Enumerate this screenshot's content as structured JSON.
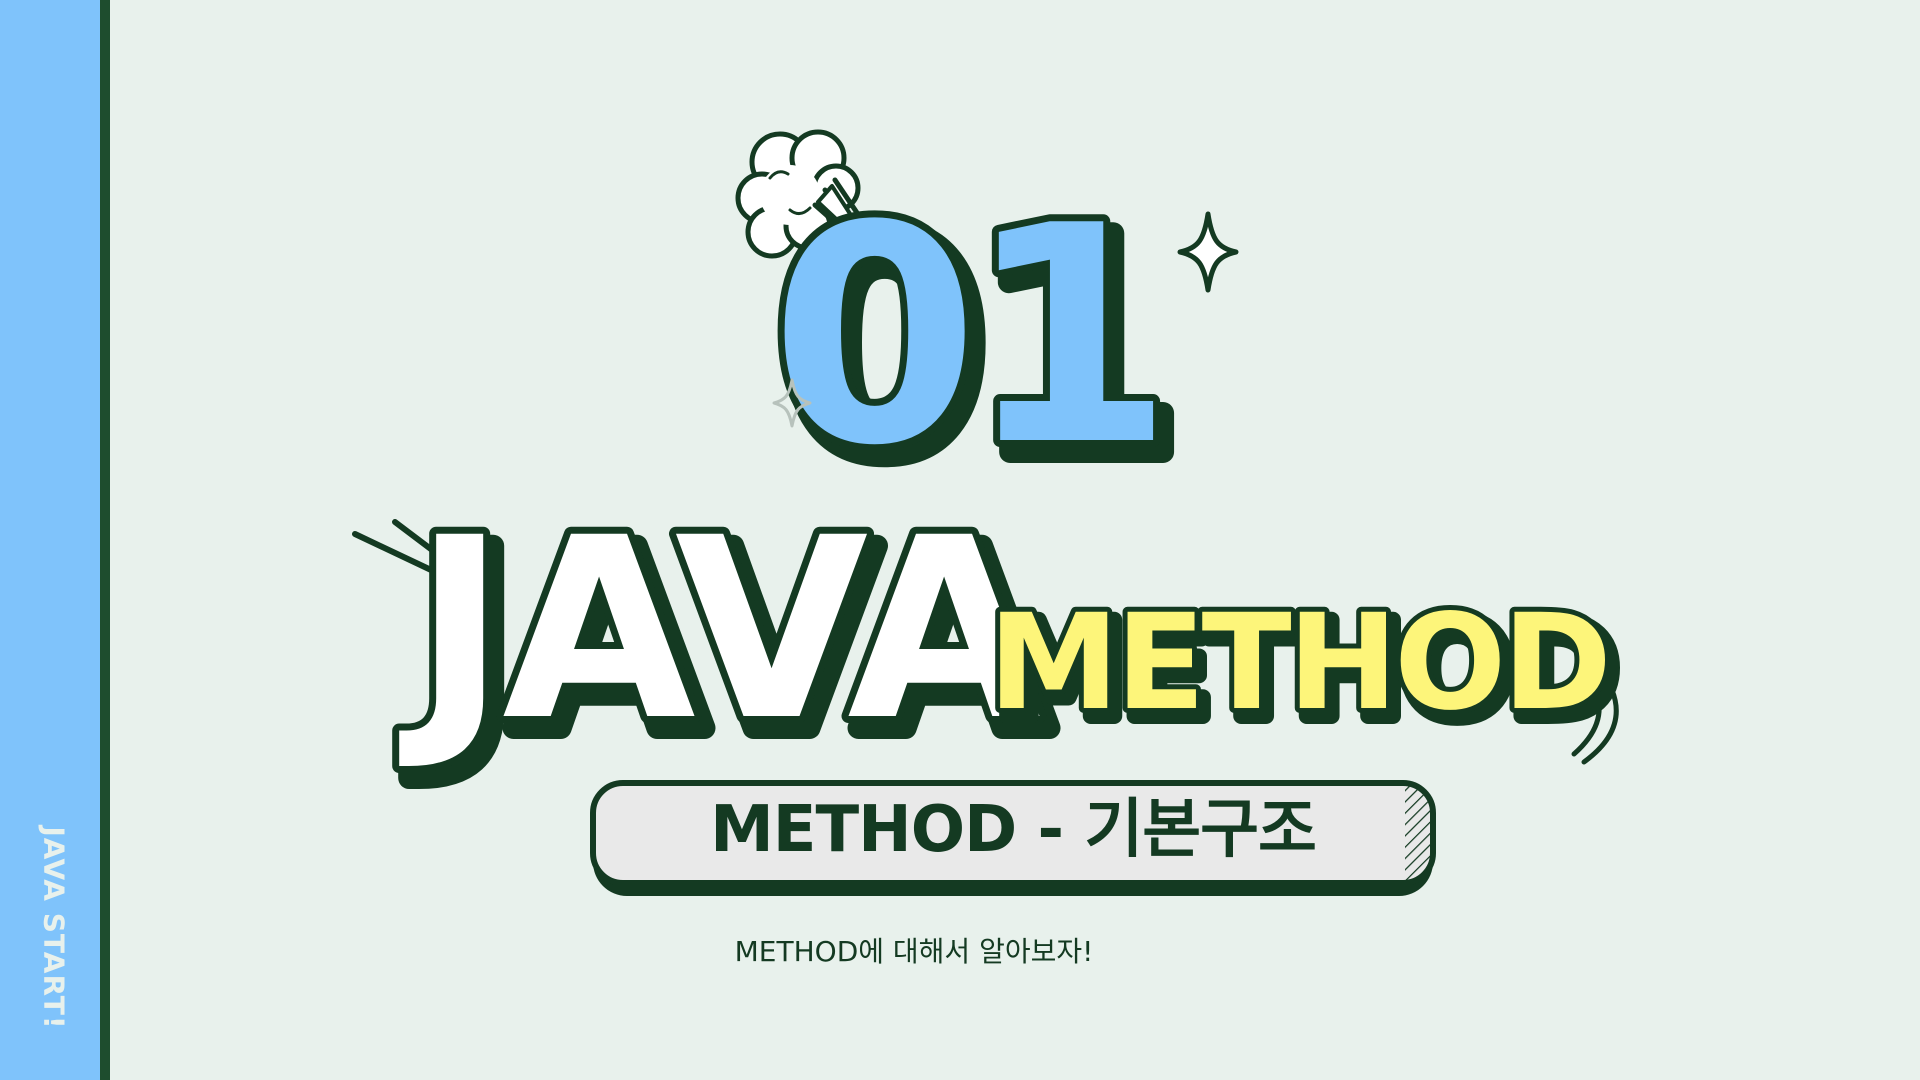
{
  "side_label": "JAVA START!",
  "number": "01",
  "title_main": "JAVA",
  "title_accent": "METHOD",
  "subtitle": "METHOD - 기본구조",
  "caption": "METHOD에 대해서 알아보자!",
  "colors": {
    "background": "#e8f1ec",
    "side_bar": "#7fc3fb",
    "outline": "#143a22",
    "number_fill": "#7fc3fb",
    "accent_fill": "#fdf57a",
    "banner_fill": "#e9e9e9"
  }
}
